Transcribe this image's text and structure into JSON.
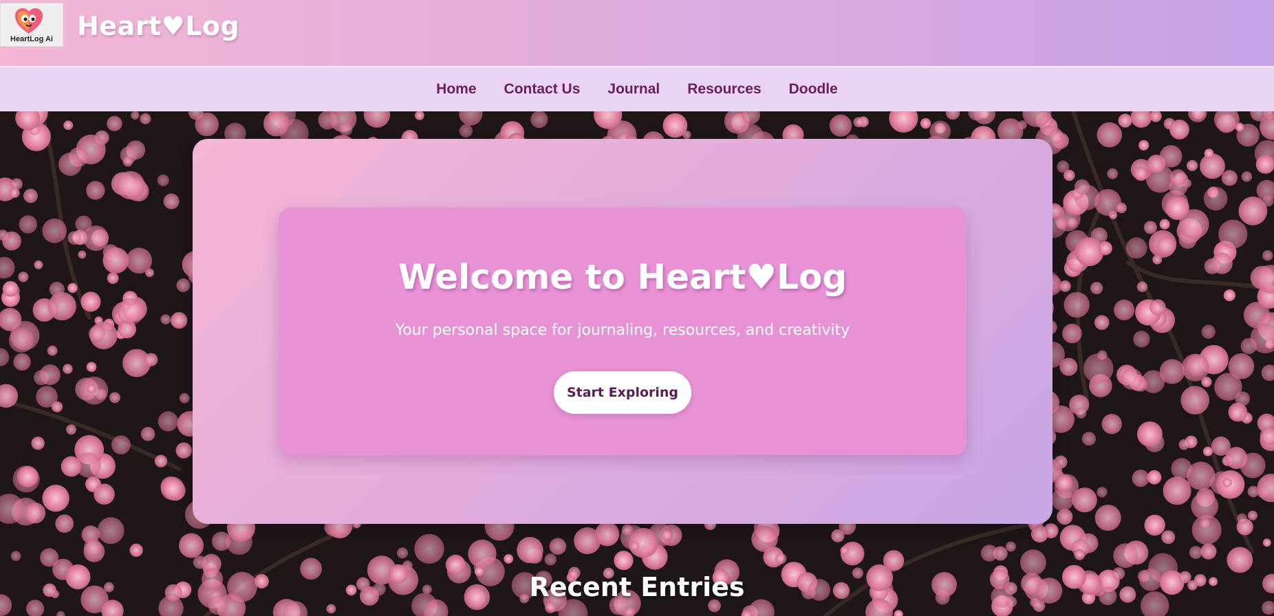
{
  "header": {
    "logo_text": "HeartLog Ai",
    "brand_title": "Heart♥Log"
  },
  "nav": {
    "items": [
      {
        "label": "Home"
      },
      {
        "label": "Contact Us"
      },
      {
        "label": "Journal"
      },
      {
        "label": "Resources"
      },
      {
        "label": "Doodle"
      }
    ]
  },
  "hero": {
    "title": "Welcome to Heart♥Log",
    "subtitle": "Your personal space for journaling, resources, and creativity",
    "button_label": "Start Exploring"
  },
  "recent": {
    "title": "Recent Entries"
  },
  "colors": {
    "nav_text": "#6a1f5c",
    "hero_inner": "#e892d6",
    "button_text": "#5b1c52"
  }
}
